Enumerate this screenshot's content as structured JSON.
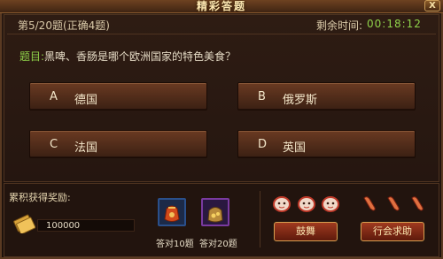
{
  "window": {
    "title": "精彩答题",
    "close_label": "X"
  },
  "status": {
    "question_count": "第5/20题(正确4题)",
    "timer_label": "剩余时间:",
    "timer_value": "00:18:12"
  },
  "question": {
    "prefix": "题目:",
    "text": "黑啤、香肠是哪个欧洲国家的特色美食？"
  },
  "options": [
    {
      "letter": "A",
      "text": "德国"
    },
    {
      "letter": "B",
      "text": "俄罗斯"
    },
    {
      "letter": "C",
      "text": "法国"
    },
    {
      "letter": "D",
      "text": "英国"
    }
  ],
  "rewards": {
    "label": "累积获得奖励:",
    "money_value": "100000",
    "items": [
      {
        "caption": "答对10题",
        "icon": "red-pouch-icon"
      },
      {
        "caption": "答对20题",
        "icon": "treasure-bag-icon"
      }
    ]
  },
  "actions": {
    "encourage_label": "鼓舞",
    "help_label": "行会求助"
  },
  "colors": {
    "accent_green": "#8fd24a",
    "panel_brown": "#2e1c13",
    "button_red": "#a03a1f",
    "title_gold": "#fbe6b0"
  }
}
